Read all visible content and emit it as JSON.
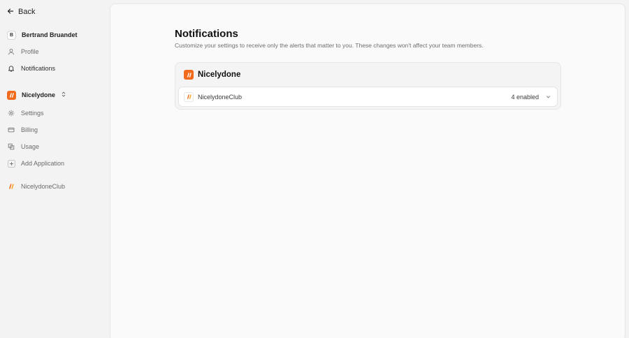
{
  "sidebar": {
    "back_label": "Back",
    "user": {
      "initial": "B",
      "name": "Bertrand Bruandet"
    },
    "account_items": [
      {
        "label": "Profile",
        "icon": "user-icon"
      },
      {
        "label": "Notifications",
        "icon": "bell-icon"
      }
    ],
    "workspace": {
      "name": "Nicelydone",
      "icon": "nicelydone-logo"
    },
    "workspace_items": [
      {
        "label": "Settings",
        "icon": "gear-icon"
      },
      {
        "label": "Billing",
        "icon": "credit-card-icon"
      },
      {
        "label": "Usage",
        "icon": "box-icon"
      },
      {
        "label": "Add Application",
        "icon": "plus-icon"
      }
    ],
    "apps": [
      {
        "label": "NicelydoneClub",
        "icon": "nicelydone-logo"
      }
    ]
  },
  "main": {
    "title": "Notifications",
    "subtitle": "Customize your settings to receive only the alerts that matter to you. These changes won't affect your team members.",
    "card": {
      "title": "Nicelydone",
      "rows": [
        {
          "name": "NicelydoneClub",
          "status": "4 enabled"
        }
      ]
    }
  },
  "colors": {
    "brand": "#f26b1d",
    "sidebar_bg": "#f3f3f3",
    "main_bg": "#fafafa"
  }
}
